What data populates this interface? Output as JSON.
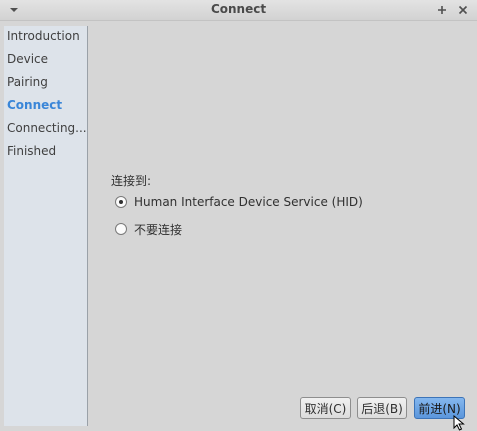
{
  "window": {
    "title": "Connect",
    "menu_icon": "chevron-down-icon",
    "pin_icon": "plus-icon",
    "close_icon": "close-icon"
  },
  "sidebar": {
    "steps": [
      {
        "label": "Introduction",
        "current": false
      },
      {
        "label": "Device",
        "current": false
      },
      {
        "label": "Pairing",
        "current": false
      },
      {
        "label": "Connect",
        "current": true
      },
      {
        "label": "Connecting...",
        "current": false
      },
      {
        "label": "Finished",
        "current": false
      }
    ]
  },
  "main": {
    "connect_to_label": "连接到:",
    "options": [
      {
        "label": "Human Interface Device Service (HID)",
        "selected": true
      },
      {
        "label": "不要连接",
        "selected": false
      }
    ]
  },
  "buttons": {
    "cancel": "取消(C)",
    "back": "后退(B)",
    "next": "前进(N)"
  },
  "colors": {
    "accent": "#3a86d8",
    "sidebar_bg": "#dde3ea",
    "window_bg": "#d6d6d6",
    "primary_button": "#6ea6e6"
  }
}
